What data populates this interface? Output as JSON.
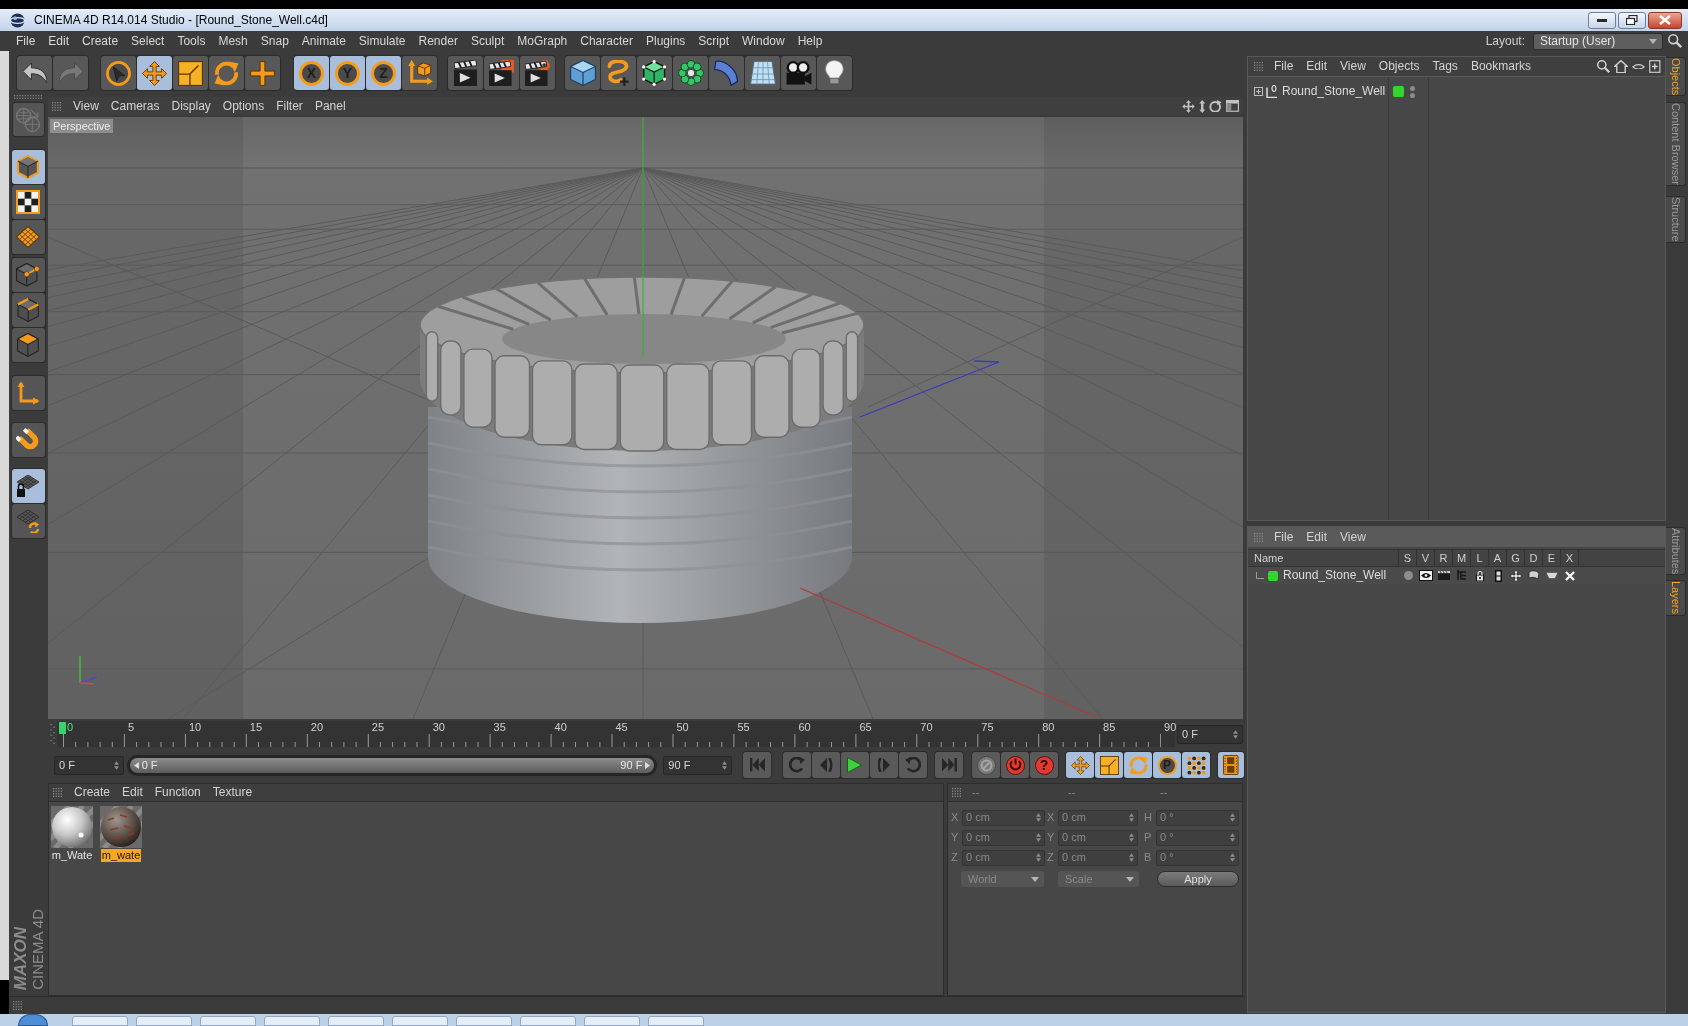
{
  "window": {
    "title": "CINEMA 4D R14.014 Studio - [Round_Stone_Well.c4d]"
  },
  "menu_bar": {
    "items": [
      "File",
      "Edit",
      "Create",
      "Select",
      "Tools",
      "Mesh",
      "Snap",
      "Animate",
      "Simulate",
      "Render",
      "Sculpt",
      "MoGraph",
      "Character",
      "Plugins",
      "Script",
      "Window",
      "Help"
    ],
    "layout_label": "Layout:",
    "layout_value": "Startup (User)"
  },
  "toolbar": {
    "history": [
      {
        "disabled": false
      },
      {
        "disabled": true
      }
    ],
    "tools": [
      {
        "selected": false
      },
      {
        "selected": true
      },
      {
        "selected": false
      },
      {
        "selected": false
      },
      {
        "selected": false
      }
    ],
    "axis_locks": [
      {
        "label": "X",
        "selected": true
      },
      {
        "label": "Y",
        "selected": true
      },
      {
        "label": "Z",
        "selected": true
      }
    ]
  },
  "mode_palette": {
    "make_editable": {
      "disabled": true
    },
    "groups": [
      {
        "buttons": [
          {
            "selected": true
          },
          {
            "selected": false
          },
          {
            "selected": false
          }
        ]
      },
      {
        "buttons": [
          {
            "selected": false
          },
          {
            "selected": false
          },
          {
            "selected": false
          }
        ]
      },
      {
        "buttons": [
          {
            "selected": false
          }
        ]
      },
      {
        "buttons": [
          {
            "selected": false
          }
        ]
      },
      {
        "buttons": [
          {
            "selected": true
          },
          {
            "selected": false
          }
        ]
      }
    ]
  },
  "logo": {
    "brand": "MAXON",
    "product": "CINEMA 4D"
  },
  "viewport": {
    "menu": [
      "View",
      "Cameras",
      "Display",
      "Options",
      "Filter",
      "Panel"
    ],
    "camera_label": "Perspective"
  },
  "timeline": {
    "ticks": [
      "0",
      "5",
      "10",
      "15",
      "20",
      "25",
      "30",
      "35",
      "40",
      "45",
      "50",
      "55",
      "60",
      "65",
      "70",
      "75",
      "80",
      "85",
      "90"
    ],
    "playhead": {
      "level": 0
    },
    "current_frame": "0 F"
  },
  "transport": {
    "start_field": "0 F",
    "range": {
      "level": 1,
      "start": "0 F",
      "end": "90 F"
    },
    "end_field": "90 F",
    "keyframe_selection_glyph": "?",
    "key_filters": [
      {
        "selected": true
      },
      {
        "selected": true
      },
      {
        "selected": true
      },
      {
        "label": "P",
        "selected": true
      },
      {
        "selected": true
      }
    ],
    "timeline_toggle": {
      "selected": true
    }
  },
  "material_manager": {
    "menu": [
      "Create",
      "Edit",
      "Function",
      "Texture"
    ],
    "materials": [
      {
        "name": "m_Wate",
        "selected": false
      },
      {
        "name": "m_wate",
        "selected": true
      }
    ]
  },
  "coordinates": {
    "disabled": true,
    "headers": [
      "--",
      "--",
      "--"
    ],
    "rows": [
      {
        "position_label": "X",
        "position": "0 cm",
        "size_label": "X",
        "size": "0 cm",
        "rotation_label": "H",
        "rotation": "0 °"
      },
      {
        "position_label": "Y",
        "position": "0 cm",
        "size_label": "Y",
        "size": "0 cm",
        "rotation_label": "P",
        "rotation": "0 °"
      },
      {
        "position_label": "Z",
        "position": "0 cm",
        "size_label": "Z",
        "size": "0 cm",
        "rotation_label": "B",
        "rotation": "0 °"
      }
    ],
    "coordinate_mode": "World",
    "size_mode": "Scale",
    "apply_label": "Apply"
  },
  "object_manager": {
    "menu": [
      "File",
      "Edit",
      "View",
      "Objects",
      "Tags",
      "Bookmarks"
    ],
    "objects": [
      {
        "name": "Round_Stone_Well",
        "expanded": false,
        "color": "#33d42b"
      }
    ]
  },
  "layer_manager": {
    "menu": [
      "File",
      "Edit",
      "View"
    ],
    "columns": [
      "Name",
      "S",
      "V",
      "R",
      "M",
      "L",
      "A",
      "G",
      "D",
      "E",
      "X"
    ],
    "layers": [
      {
        "name": "Round_Stone_Well",
        "color": "#33d42b"
      }
    ]
  },
  "side_tabs": {
    "upper": [
      {
        "label": "Objects",
        "selected": true
      },
      {
        "label": "Content Browser",
        "selected": false
      },
      {
        "label": "Structure",
        "selected": false
      }
    ],
    "lower": [
      {
        "label": "Attributes",
        "selected": false
      },
      {
        "label": "Layers",
        "selected": true
      }
    ]
  }
}
